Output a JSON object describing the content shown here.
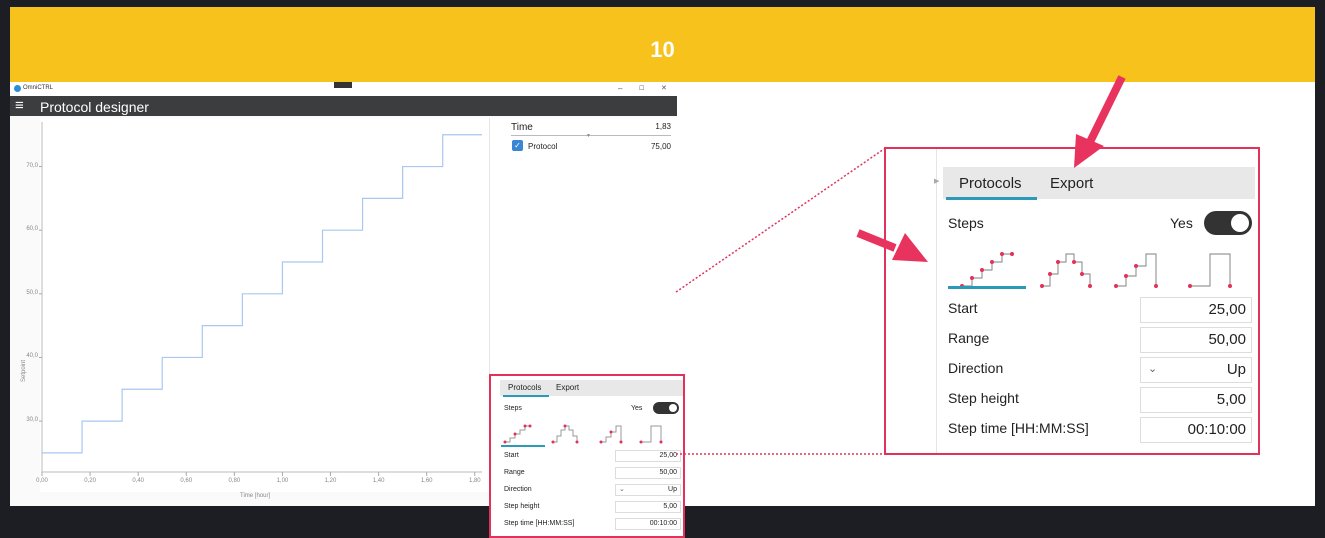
{
  "banner": {
    "number": "10"
  },
  "window": {
    "app_name": "OmniCTRL",
    "minimize": "–",
    "maximize": "☐",
    "close": "✕"
  },
  "header": {
    "menu_icon": "hamburger-icon",
    "title": "Protocol designer"
  },
  "side": {
    "time_label": "Time",
    "time_value": "1,83",
    "protocol_label": "Protocol",
    "protocol_value": "75,00",
    "protocol_checked": true
  },
  "panel": {
    "tabs": [
      "Protocols",
      "Export"
    ],
    "active_tab": "Protocols",
    "steps_label": "Steps",
    "steps_toggle_label": "Yes",
    "steps_toggle_on": true,
    "pattern_icons": [
      "steps-up-icon",
      "steps-up-down-icon",
      "steps-up-drop-icon",
      "step-pulse-icon"
    ],
    "fields": [
      {
        "label": "Start",
        "value": "25,00"
      },
      {
        "label": "Range",
        "value": "50,00"
      },
      {
        "label": "Direction",
        "value": "Up",
        "dropdown": true
      },
      {
        "label": "Step height",
        "value": "5,00"
      },
      {
        "label": "Step time [HH:MM:SS]",
        "value": "00:10:00"
      }
    ]
  },
  "chart_data": {
    "type": "line",
    "xlabel": "Time [hour]",
    "ylabel": "Setpoint",
    "xlim": [
      0,
      1.83
    ],
    "ylim": [
      22,
      77
    ],
    "x_ticks": [
      "0,00",
      "0,20",
      "0,40",
      "0,60",
      "0,80",
      "1,00",
      "1,20",
      "1,40",
      "1,60",
      "1,80"
    ],
    "y_ticks": [
      "30,0",
      "40,0",
      "50,0",
      "60,0",
      "70,0"
    ],
    "series": [
      {
        "color": "#a8c8f0",
        "x": [
          0.0,
          0.1667,
          0.1667,
          0.3333,
          0.3333,
          0.5,
          0.5,
          0.6667,
          0.6667,
          0.8333,
          0.8333,
          1.0,
          1.0,
          1.1667,
          1.1667,
          1.3333,
          1.3333,
          1.5,
          1.5,
          1.6667,
          1.6667,
          1.83
        ],
        "y": [
          25,
          25,
          30,
          30,
          35,
          35,
          40,
          40,
          45,
          45,
          50,
          50,
          55,
          55,
          60,
          60,
          65,
          65,
          70,
          70,
          75,
          75
        ]
      }
    ]
  },
  "colors": {
    "banner": "#f6c21b",
    "highlight": "#e0325a",
    "tab_underline": "#2b9ab8",
    "header": "#3c3d3e"
  }
}
